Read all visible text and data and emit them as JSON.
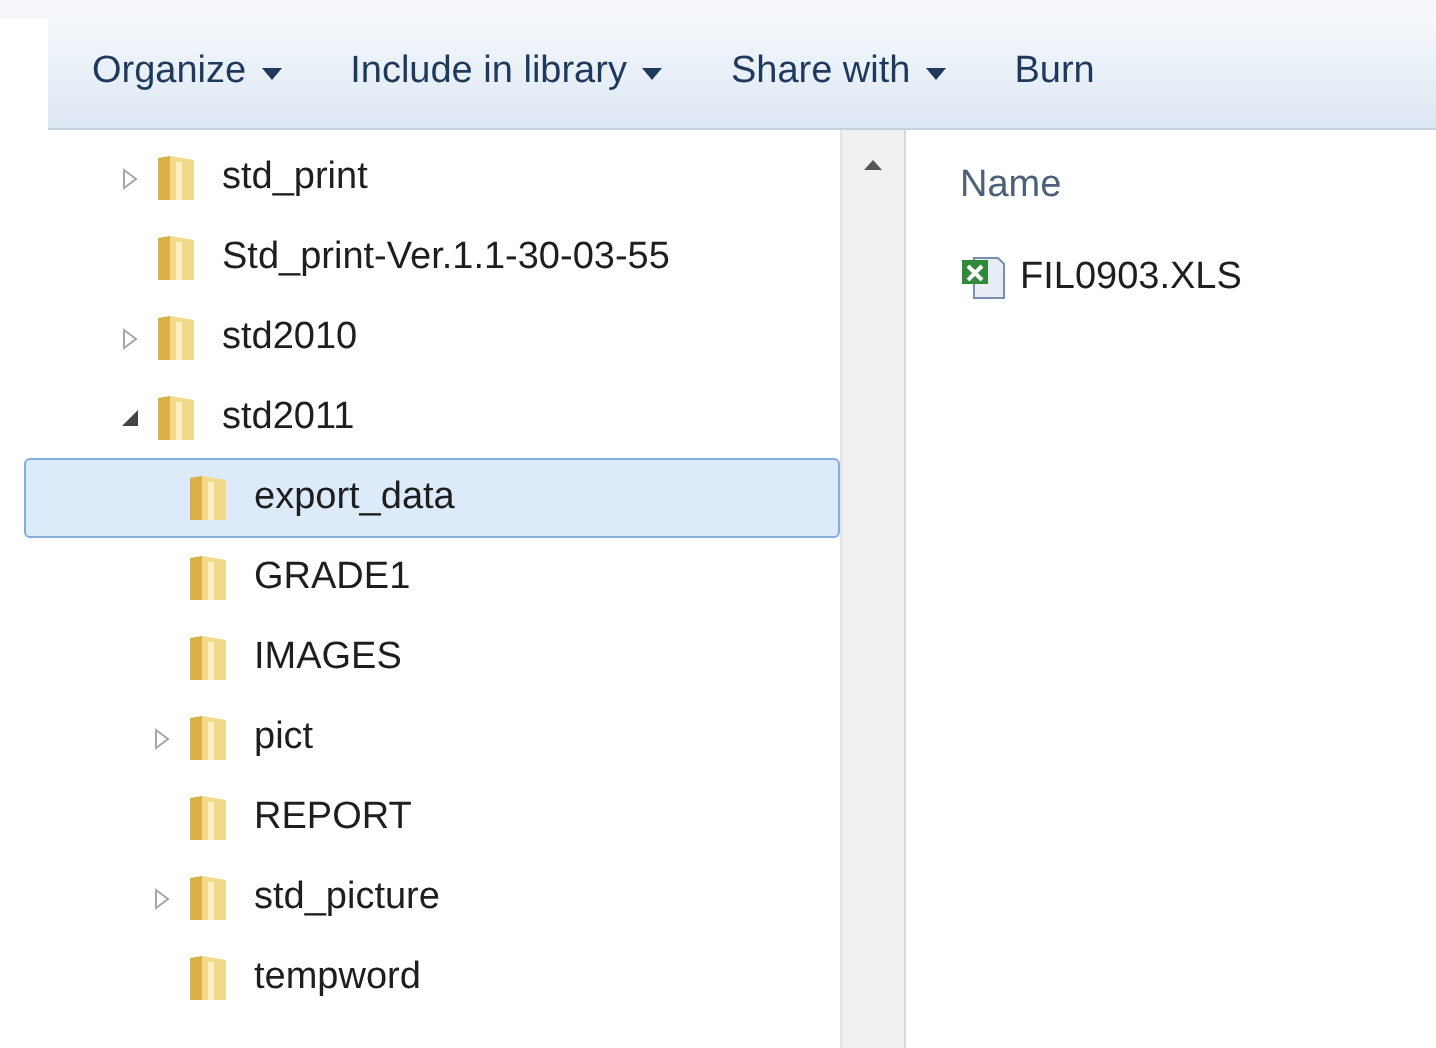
{
  "toolbar": {
    "buttons": [
      {
        "label": "Organize",
        "dropdown": true
      },
      {
        "label": "Include in library",
        "dropdown": true
      },
      {
        "label": "Share with",
        "dropdown": true
      },
      {
        "label": "Burn",
        "dropdown": false
      }
    ]
  },
  "tree": [
    {
      "label": "std_print",
      "expanded": false,
      "selected": false
    },
    {
      "label": "Std_print-Ver.1.1-30-03-55",
      "selected": false
    },
    {
      "label": "std2010",
      "expanded": false,
      "selected": false
    },
    {
      "label": "std2011",
      "expanded": true,
      "selected": false,
      "children": [
        {
          "label": "export_data",
          "selected": true
        },
        {
          "label": "GRADE1",
          "selected": false
        },
        {
          "label": "IMAGES",
          "selected": false
        },
        {
          "label": "pict",
          "expanded": false,
          "selected": false
        },
        {
          "label": "REPORT",
          "selected": false
        },
        {
          "label": "std_picture",
          "expanded": false,
          "selected": false
        },
        {
          "label": "tempword",
          "selected": false
        }
      ]
    }
  ],
  "file_list": {
    "columns": [
      "Name"
    ],
    "files": [
      {
        "name": "FIL0903.XLS",
        "selected": false
      }
    ]
  }
}
